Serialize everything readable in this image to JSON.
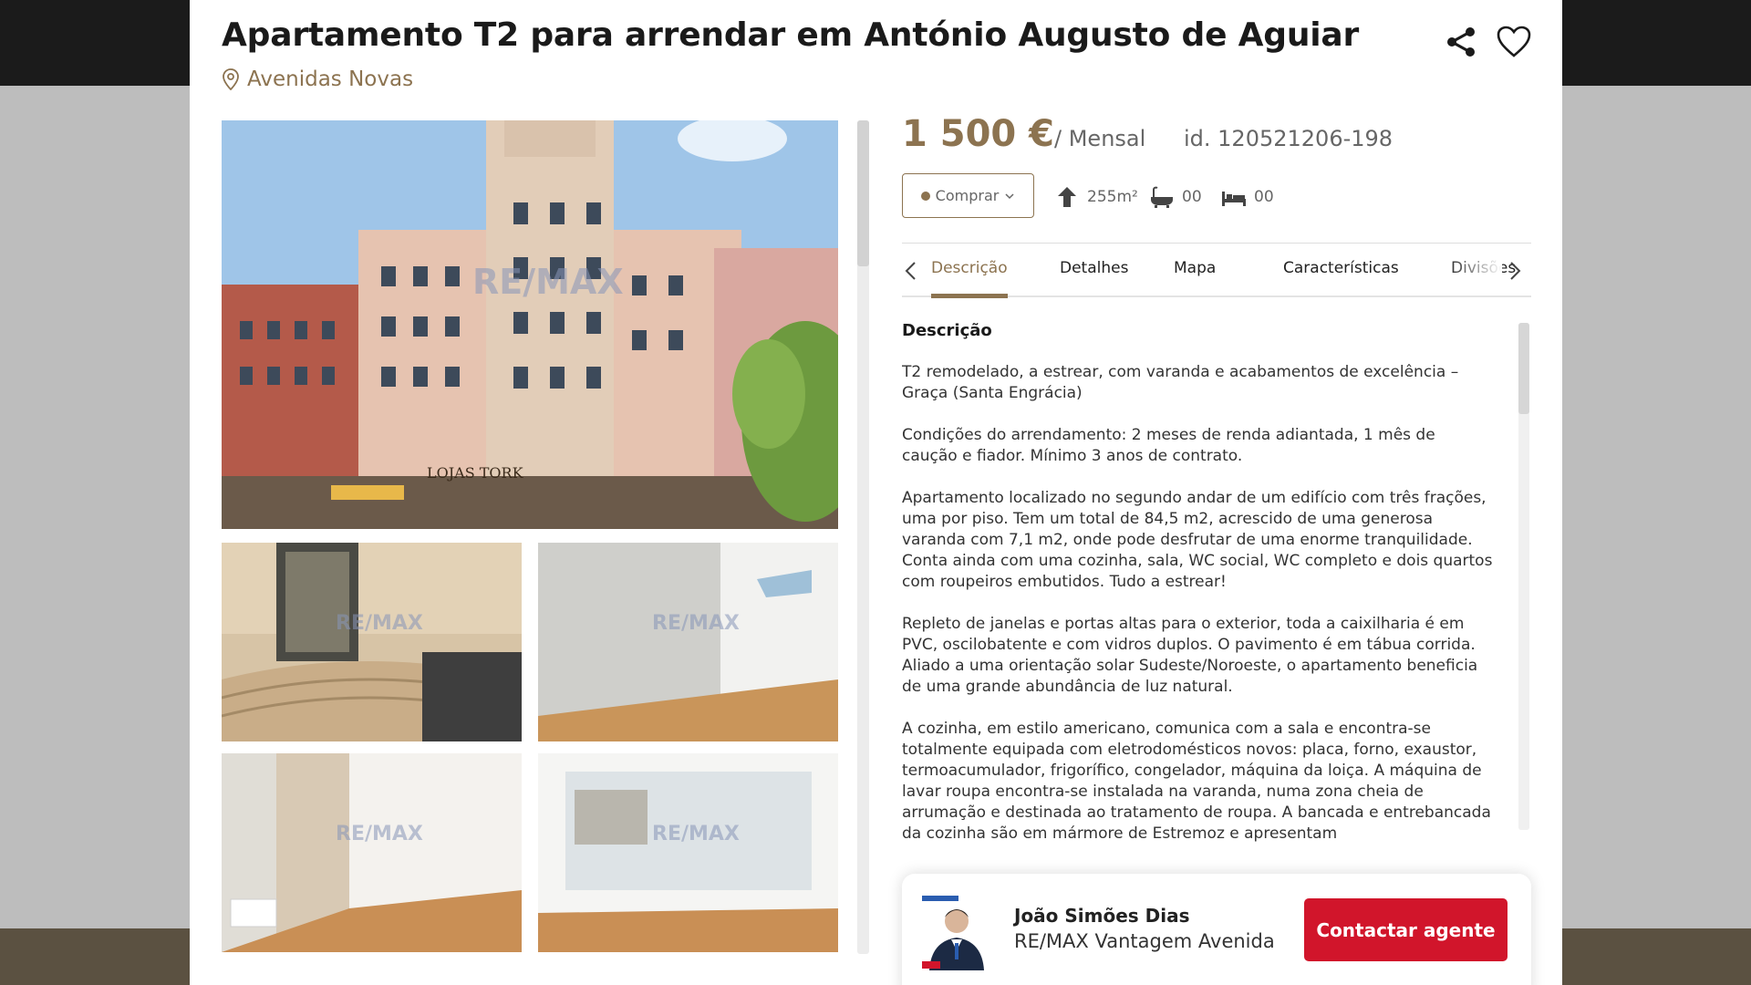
{
  "listing": {
    "title": "Apartamento T2 para arrendar em António Augusto de Aguiar",
    "location": "Avenidas Novas",
    "price": "1 500 €",
    "period": "/ Mensal",
    "id": "id. 120521206-198"
  },
  "actions": {
    "buy_label": "Comprar",
    "share_icon": "share-icon",
    "favorite_icon": "heart-icon"
  },
  "specs": {
    "area": "255m²",
    "bathrooms": "00",
    "bedrooms": "00"
  },
  "tabs": [
    {
      "label": "Descrição",
      "active": true
    },
    {
      "label": "Detalhes",
      "active": false
    },
    {
      "label": "Mapa",
      "active": false
    },
    {
      "label": "Características",
      "active": false
    },
    {
      "label": "Divisões",
      "active": false
    }
  ],
  "description": {
    "heading": "Descrição",
    "paragraphs": [
      "T2 remodelado, a estrear, com varanda e acabamentos de excelência – Graça (Santa Engrácia)",
      "Condições do arrendamento: 2 meses de renda adiantada, 1 mês de caução e fiador. Mínimo 3 anos de contrato.",
      "Apartamento localizado no segundo andar de um edifício com três frações, uma por piso. Tem um total de 84,5 m2, acrescido de uma generosa varanda com 7,1 m2, onde pode desfrutar de uma enorme tranquilidade. Conta ainda com uma cozinha, sala, WC social, WC completo e dois quartos com roupeiros embutidos. Tudo a estrear!",
      "Repleto de janelas e portas altas para o exterior, toda a caixilharia é em PVC, oscilobatente e com vidros duplos. O pavimento é em tábua corrida. Aliado a uma orientação solar Sudeste/Noroeste, o apartamento beneficia de uma grande abundância de luz natural.",
      "A cozinha, em estilo americano, comunica com a sala e encontra-se totalmente equipada com eletrodomésticos novos: placa, forno, exaustor, termoacumulador, frigorífico, congelador, máquina da loiça. A máquina de lavar roupa encontra-se instalada na varanda, numa zona cheia de arrumação e destinada ao tratamento de roupa. A bancada e entrebancada da cozinha são em mármore de Estremoz e apresentam"
    ]
  },
  "photos": {
    "watermark": "RE/MAX",
    "storefront": "LOJAS TORK"
  },
  "agent": {
    "name": "João Simões Dias",
    "office": "RE/MAX Vantagem Avenida",
    "contact_label": "Contactar agente"
  },
  "colors": {
    "accent": "#8c7350",
    "cta": "#d1152b"
  }
}
